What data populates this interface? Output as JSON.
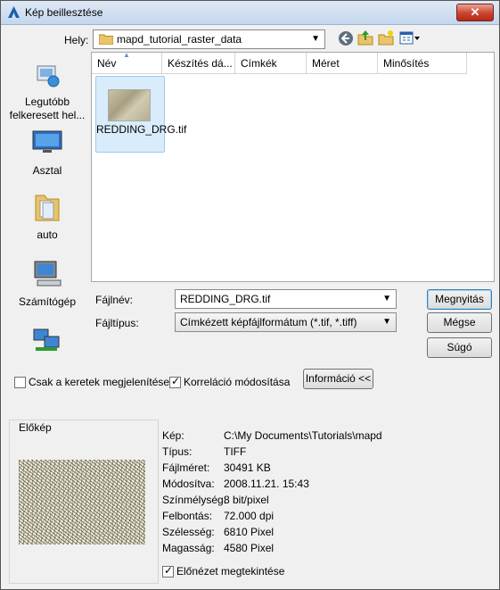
{
  "window": {
    "title": "Kép beillesztése",
    "close_label": "✕"
  },
  "location": {
    "label": "Hely:",
    "value": "mapd_tutorial_raster_data"
  },
  "places": [
    {
      "label": "Legutóbb felkeresett hel...",
      "icon": "recent-places-icon"
    },
    {
      "label": "Asztal",
      "icon": "desktop-icon"
    },
    {
      "label": "auto",
      "icon": "folder-icon"
    },
    {
      "label": "Számítógép",
      "icon": "computer-icon"
    },
    {
      "label": "",
      "icon": "network-icon"
    }
  ],
  "columns": [
    "Név",
    "Készítés dá...",
    "Címkék",
    "Méret",
    "Minősítés"
  ],
  "files": [
    {
      "name": "REDDING_DRG.tif"
    }
  ],
  "filename": {
    "label": "Fájlnév:",
    "value": "REDDING_DRG.tif"
  },
  "filetype": {
    "label": "Fájltípus:",
    "value": "Címkézett képfájlformátum (*.tif, *.tiff)"
  },
  "buttons": {
    "open": "Megnyitás",
    "cancel": "Mégse",
    "help": "Súgó",
    "info": "Információ <<"
  },
  "options": {
    "frames_only": {
      "label": "Csak a keretek megjelenítése",
      "checked": false
    },
    "correlation": {
      "label": "Korreláció módosítása",
      "checked": true
    }
  },
  "preview": {
    "legend": "Előkép",
    "show_preview": {
      "label": "Előnézet megtekintése",
      "checked": true
    }
  },
  "info": [
    {
      "key": "Kép:",
      "value": "C:\\My Documents\\Tutorials\\mapd"
    },
    {
      "key": "Típus:",
      "value": "TIFF"
    },
    {
      "key": "Fájlméret:",
      "value": "30491 KB"
    },
    {
      "key": "Módosítva:",
      "value": "2008.11.21. 15:43"
    },
    {
      "key": "Színmélység:",
      "value": "8 bit/pixel"
    },
    {
      "key": "Felbontás:",
      "value": "72.000 dpi"
    },
    {
      "key": "Szélesség:",
      "value": "6810 Pixel"
    },
    {
      "key": "Magasság:",
      "value": "4580 Pixel"
    }
  ]
}
